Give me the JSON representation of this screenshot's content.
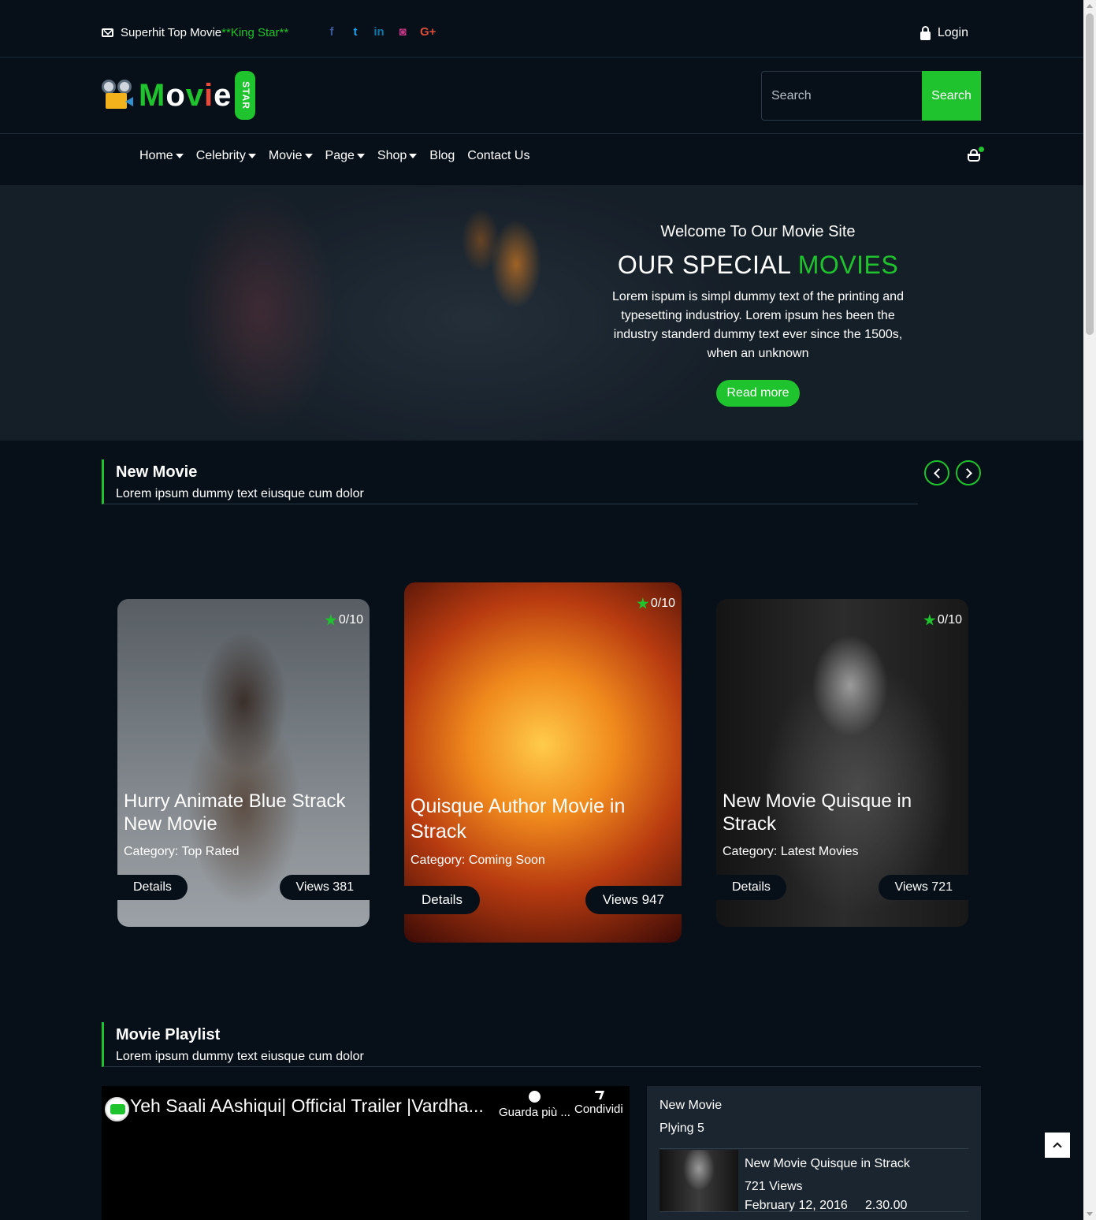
{
  "topbar": {
    "tagline": "Superhit Top Movie",
    "tagline_highlight": "**King Star**",
    "socials": [
      {
        "icon": "facebook-icon",
        "glyph": "f",
        "color": "#3b5998"
      },
      {
        "icon": "twitter-icon",
        "glyph": "t",
        "color": "#1da1f2"
      },
      {
        "icon": "linkedin-icon",
        "glyph": "in",
        "color": "#0e76a8"
      },
      {
        "icon": "instagram-icon",
        "glyph": "◙",
        "color": "#c13584"
      },
      {
        "icon": "google-plus-icon",
        "glyph": "G+",
        "color": "#dd4b39"
      }
    ],
    "login_label": "Login"
  },
  "header": {
    "logo_text": "Movie",
    "logo_badge": "STAR",
    "search_placeholder": "Search",
    "search_button": "Search"
  },
  "nav": {
    "items": [
      {
        "label": "Home",
        "has_dropdown": true
      },
      {
        "label": "Celebrity",
        "has_dropdown": true
      },
      {
        "label": "Movie",
        "has_dropdown": true
      },
      {
        "label": "Page",
        "has_dropdown": true
      },
      {
        "label": "Shop",
        "has_dropdown": true
      },
      {
        "label": "Blog",
        "has_dropdown": false
      },
      {
        "label": "Contact Us",
        "has_dropdown": false
      }
    ]
  },
  "hero": {
    "subtitle": "Welcome To Our Movie Site",
    "title_white": "OUR SPECIAL",
    "title_green": "MOVIES",
    "description": "Lorem ispum is simpl dummy text of the printing and typesetting industrioy. Lorem ipsum hes been the industry standerd dummy text ever since the 1500s, when an unknown",
    "cta": "Read more"
  },
  "new_movie": {
    "title": "New Movie",
    "subtitle": "Lorem ipsum dummy text eiusque cum dolor",
    "cards": [
      {
        "title": "Hurry Animate Blue Strack New Movie",
        "category": "Category: Top Rated",
        "rating": "0/10",
        "details": "Details",
        "views": "Views 381"
      },
      {
        "title": "Quisque Author Movie in Strack",
        "category": "Category: Coming Soon",
        "rating": "0/10",
        "details": "Details",
        "views": "Views 947"
      },
      {
        "title": "New Movie Quisque in Strack",
        "category": "Category: Latest Movies",
        "rating": "0/10",
        "details": "Details",
        "views": "Views 721"
      }
    ]
  },
  "playlist": {
    "title": "Movie Playlist",
    "subtitle": "Lorem ipsum dummy text eiusque cum dolor",
    "video": {
      "title": "Yeh Saali AAshiqui| Official Trailer |Vardha...",
      "watch_later": "Guarda più ...",
      "share": "Condividi"
    },
    "list": {
      "heading": "New Movie",
      "playing": "Plying 5",
      "item": {
        "title": "New Movie Quisque in Strack",
        "views": "721 Views",
        "date": "February 12, 2016",
        "time": "2.30.00"
      }
    }
  },
  "colors": {
    "accent": "#1fc32d",
    "background": "#071019",
    "panel": "#1a2530"
  }
}
